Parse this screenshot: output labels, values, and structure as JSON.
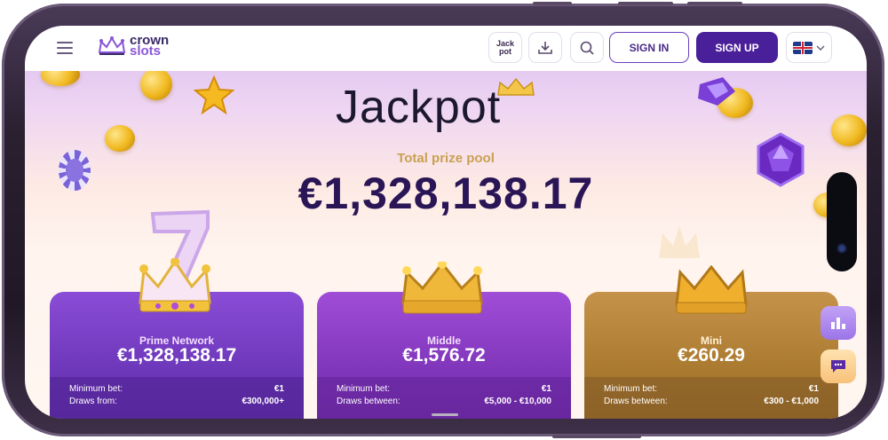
{
  "header": {
    "logo": {
      "line1": "crown",
      "line2": "slots"
    },
    "jackpot_btn": {
      "line1": "Jack",
      "line2": "pot"
    },
    "signin_label": "SIGN IN",
    "signup_label": "SIGN UP"
  },
  "hero": {
    "title": "Jackpot",
    "prize_label": "Total prize pool",
    "prize_amount": "€1,328,138.17"
  },
  "cards": [
    {
      "name": "Prime Network",
      "amount": "€1,328,138.17",
      "min_bet_label": "Minimum bet:",
      "min_bet": "€1",
      "draws_label": "Draws from:",
      "draws": "€300,000+"
    },
    {
      "name": "Middle",
      "amount": "€1,576.72",
      "min_bet_label": "Minimum bet:",
      "min_bet": "€1",
      "draws_label": "Draws between:",
      "draws": "€5,000 - €10,000"
    },
    {
      "name": "Mini",
      "amount": "€260.29",
      "min_bet_label": "Minimum bet:",
      "min_bet": "€1",
      "draws_label": "Draws between:",
      "draws": "€300 - €1,000"
    }
  ],
  "colors": {
    "brand_primary": "#4a1f9a",
    "gold": "#c9a052",
    "prize_text": "#2a1556"
  },
  "icons": [
    "menu-icon",
    "crown-logo-icon",
    "download-icon",
    "search-icon",
    "uk-flag-icon",
    "chevron-down-icon",
    "leaderboard-icon",
    "chat-icon"
  ]
}
